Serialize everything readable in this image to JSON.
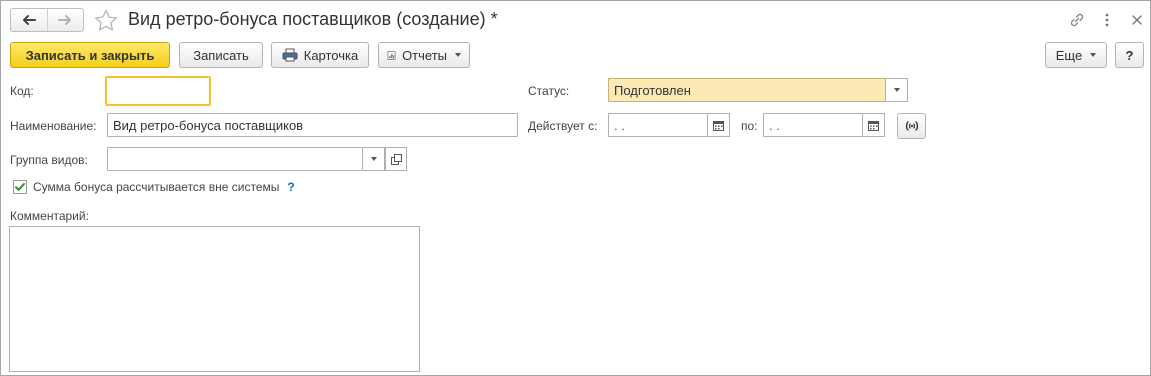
{
  "window": {
    "title": "Вид ретро-бонуса поставщиков (создание) *"
  },
  "toolbar": {
    "save_close_label": "Записать и закрыть",
    "save_label": "Записать",
    "card_label": "Карточка",
    "reports_label": "Отчеты",
    "more_label": "Еще",
    "help_label": "?"
  },
  "form": {
    "code": {
      "label": "Код:",
      "value": ""
    },
    "name": {
      "label": "Наименование:",
      "value": "Вид ретро-бонуса поставщиков"
    },
    "group": {
      "label": "Группа видов:",
      "value": ""
    },
    "bonus_check": {
      "label": "Сумма бонуса рассчитывается вне системы",
      "checked": true,
      "help": "?"
    },
    "comment": {
      "label": "Комментарий:",
      "value": ""
    },
    "status": {
      "label": "Статус:",
      "value": "Подготовлен"
    },
    "valid_from": {
      "label": "Действует с:",
      "value": " .  ."
    },
    "valid_to": {
      "label": "по:",
      "value": " .  ."
    }
  },
  "colors": {
    "primary_button": "#f6cf1a",
    "focus_border": "#f4c430",
    "status_field_bg": "#fde9b3",
    "help_link": "#1a6fb3"
  }
}
